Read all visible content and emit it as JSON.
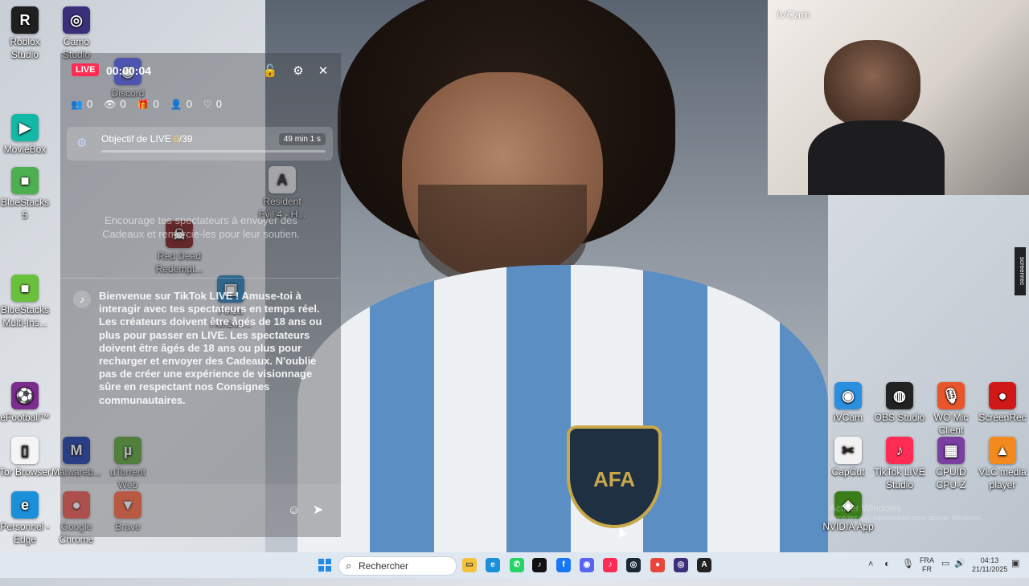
{
  "desktop": {
    "icons_left": [
      {
        "label": "Roblox Studio",
        "icon": "roblox-icon",
        "color": "#1f1f1f",
        "glyph": "R"
      },
      {
        "label": "Camo Studio",
        "icon": "camo-icon",
        "color": "#3b2f7a",
        "glyph": "◎"
      },
      {
        "label": "Discord",
        "icon": "discord-icon",
        "color": "#5865f2",
        "glyph": "◉"
      },
      {
        "label": "MovieBox",
        "icon": "moviebox-icon",
        "color": "#14b8a6",
        "glyph": "▶"
      },
      {
        "label": "BlueStacks 5",
        "icon": "bluestacks-icon",
        "color": "#4caf50",
        "glyph": "■"
      },
      {
        "label": "BlueStacks Multi-Ins...",
        "icon": "bluestacks-multi-icon",
        "color": "#69c03a",
        "glyph": "■"
      },
      {
        "label": "eFootball™",
        "icon": "efootball-icon",
        "color": "#7b2c8c",
        "glyph": "⚽"
      },
      {
        "label": "Tor Browser",
        "icon": "tor-icon",
        "color": "#f5f5f5",
        "glyph": "▯"
      },
      {
        "label": "Malwareb...",
        "icon": "malwarebytes-icon",
        "color": "#1e40af",
        "glyph": "M"
      },
      {
        "label": "uTorrent Web",
        "icon": "utorrent-icon",
        "color": "#5fa83a",
        "glyph": "µ"
      },
      {
        "label": "Personnel - Edge",
        "icon": "edge-icon",
        "color": "#1b8fd8",
        "glyph": "e"
      },
      {
        "label": "Google Chrome",
        "icon": "chrome-icon",
        "color": "#e8453c",
        "glyph": "●"
      },
      {
        "label": "Brave",
        "icon": "brave-icon",
        "color": "#fb542b",
        "glyph": "▼"
      },
      {
        "label": "Resident Evil 4 - H...",
        "icon": "resident-evil-icon",
        "color": "#e6e6e6",
        "glyph": "A"
      },
      {
        "label": "Red Dead Redempt...",
        "icon": "red-dead-icon",
        "color": "#7a1c1c",
        "glyph": "☠"
      },
      {
        "label": "Forza Horizon...",
        "icon": "forza-icon",
        "color": "#2980b9",
        "glyph": "▣"
      }
    ],
    "icons_right": [
      {
        "label": "iVCam",
        "icon": "ivcam-icon",
        "color": "#2b8fe0",
        "glyph": "◉"
      },
      {
        "label": "OBS Studio",
        "icon": "obs-icon",
        "color": "#222222",
        "glyph": "◍"
      },
      {
        "label": "WO Mic Client",
        "icon": "womic-icon",
        "color": "#e8552a",
        "glyph": "🎙"
      },
      {
        "label": "ScreenRec",
        "icon": "screenrec-icon",
        "color": "#d01818",
        "glyph": "●"
      },
      {
        "label": "CapCut",
        "icon": "capcut-icon",
        "color": "#f2f2f2",
        "glyph": "✂"
      },
      {
        "label": "TikTok LIVE Studio",
        "icon": "tiktok-live-icon",
        "color": "#fe2c55",
        "glyph": "♪"
      },
      {
        "label": "CPUID CPU-Z",
        "icon": "cpuz-icon",
        "color": "#7a3fa0",
        "glyph": "▦"
      },
      {
        "label": "VLC media player",
        "icon": "vlc-icon",
        "color": "#f48a1d",
        "glyph": "▲"
      },
      {
        "label": "NVIDIA App",
        "icon": "nvidia-icon",
        "color": "#3a7d1a",
        "glyph": "◈"
      }
    ],
    "watermark_title": "Activer Windows",
    "watermark_sub": "Accédez aux paramètres pour activer Windows.",
    "photo_badge": "AFA",
    "side_tag": "screenrec"
  },
  "webcam": {
    "label": "iVCam"
  },
  "live_panel": {
    "live_badge": "LIVE",
    "timer": "00:00:04",
    "stats": [
      {
        "icon": "viewers-icon",
        "glyph": "👥",
        "value": "0"
      },
      {
        "icon": "eye-icon",
        "glyph": "👁",
        "value": "0"
      },
      {
        "icon": "gift-icon",
        "glyph": "🎁",
        "value": "0"
      },
      {
        "icon": "follow-icon",
        "glyph": "👤",
        "value": "0"
      },
      {
        "icon": "heart-icon",
        "glyph": "♡",
        "value": "0"
      }
    ],
    "goal": {
      "title": "Objectif de LIVE",
      "current": "0",
      "target": "/39",
      "time": "49 min 1 s"
    },
    "encourage": "Encourage tes spectateurs à envoyer des Cadeaux et remercie-les pour leur soutien.",
    "welcome": "Bienvenue sur TikTok LIVE ! Amuse-toi à interagir avec tes spectateurs en temps réel. Les créateurs doivent être âgés de 18 ans ou plus pour passer en LIVE. Les spectateurs doivent être âgés de 18 ans ou plus pour recharger et envoyer des Cadeaux. N'oublie pas de créer une expérience de visionnage sûre en respectant nos Consignes communautaires."
  },
  "taskbar": {
    "search_placeholder": "Rechercher",
    "apps": [
      {
        "icon": "file-explorer-icon",
        "color": "#f3c13a",
        "glyph": "▭"
      },
      {
        "icon": "edge-icon",
        "color": "#1b8fd8",
        "glyph": "e"
      },
      {
        "icon": "whatsapp-icon",
        "color": "#25d366",
        "glyph": "✆"
      },
      {
        "icon": "tiktok-icon",
        "color": "#111111",
        "glyph": "♪"
      },
      {
        "icon": "facebook-icon",
        "color": "#1877f2",
        "glyph": "f"
      },
      {
        "icon": "discord-icon",
        "color": "#5865f2",
        "glyph": "◉"
      },
      {
        "icon": "tiktok-live-icon",
        "color": "#fe2c55",
        "glyph": "♪"
      },
      {
        "icon": "steam-icon",
        "color": "#1b2838",
        "glyph": "◎"
      },
      {
        "icon": "chrome-icon",
        "color": "#e8453c",
        "glyph": "●"
      },
      {
        "icon": "camo-icon",
        "color": "#3b2f7a",
        "glyph": "◎"
      },
      {
        "icon": "resident-evil-icon",
        "color": "#222222",
        "glyph": "A"
      }
    ],
    "lang_top": "FRA",
    "lang_bottom": "FR",
    "time": "04:13",
    "date": "21/11/2025"
  }
}
